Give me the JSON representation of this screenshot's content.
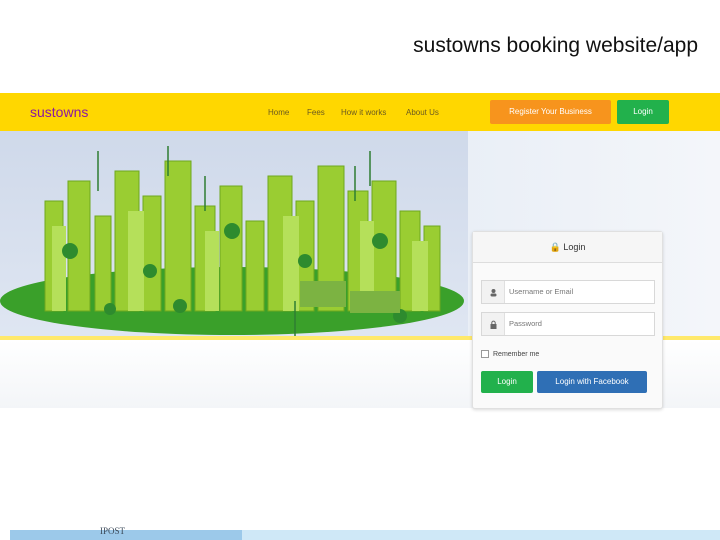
{
  "slide": {
    "title": "sustowns booking website/app",
    "footer_text": "IPOST"
  },
  "navbar": {
    "brand": "sustowns",
    "links": [
      "Home",
      "Fees",
      "How it works",
      "About Us"
    ],
    "register_label": "Register Your Business",
    "login_label": "Login"
  },
  "login_card": {
    "title": "Login",
    "username_placeholder": "Username or Email",
    "password_placeholder": "Password",
    "remember_label": "Remember me",
    "login_button": "Login",
    "facebook_button": "Login with Facebook"
  },
  "colors": {
    "navbar_bg": "#ffd700",
    "brand": "#8b1aa0",
    "register_button": "#f7941d",
    "login_button": "#22b14c",
    "facebook_button": "#2f6fb5",
    "city_green": "#8cc63f"
  },
  "icons": [
    "lock-icon",
    "user-icon",
    "padlock-icon",
    "wind-turbine-icon",
    "tree-icon"
  ]
}
